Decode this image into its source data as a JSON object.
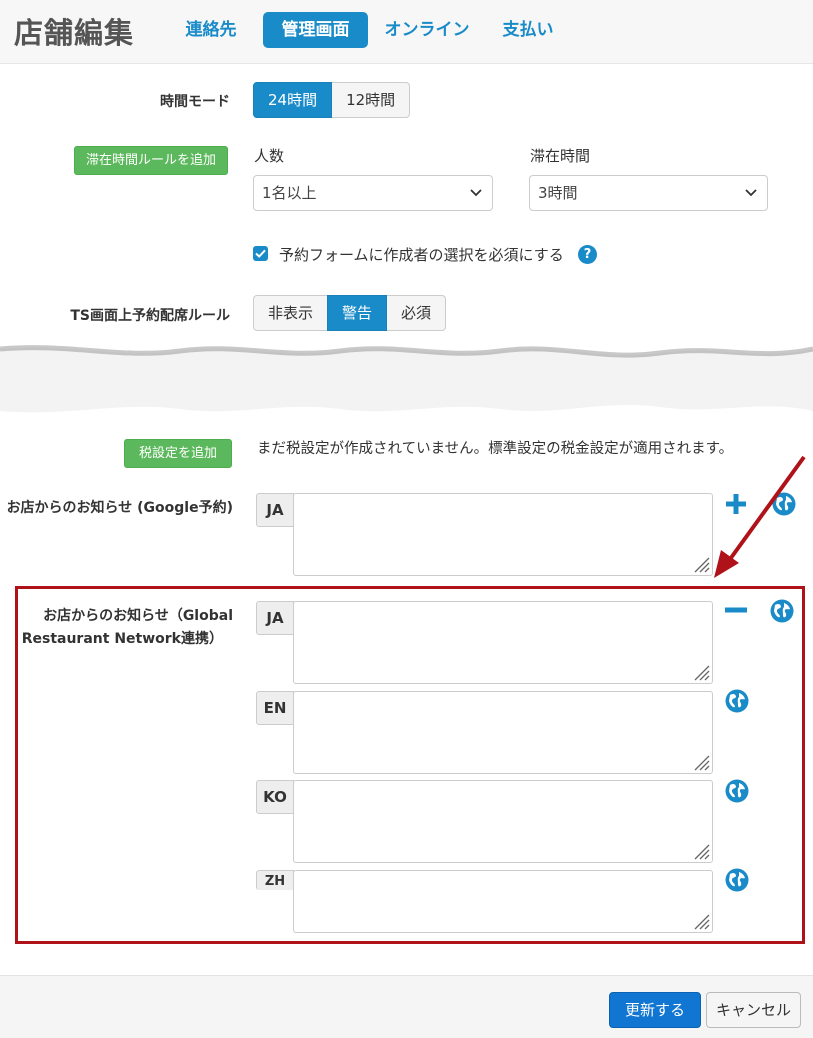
{
  "header": {
    "title": "店舗編集",
    "tabs": [
      {
        "label": "連絡先",
        "active": false
      },
      {
        "label": "管理画面",
        "active": true
      },
      {
        "label": "オンライン",
        "active": false
      },
      {
        "label": "支払い",
        "active": false
      }
    ]
  },
  "time_mode": {
    "label": "時間モード",
    "options": [
      "24時間",
      "12時間"
    ],
    "selected": "24時間"
  },
  "stay_rule": {
    "add_button": "滞在時間ルールを追加",
    "people_label": "人数",
    "people_value": "1名以上",
    "duration_label": "滞在時間",
    "duration_value": "3時間"
  },
  "creator_required": {
    "label": "予約フォームに作成者の選択を必須にする",
    "checked": true
  },
  "ts_rule": {
    "label": "TS画面上予約配席ルール",
    "options": [
      "非表示",
      "警告",
      "必須"
    ],
    "selected": "警告"
  },
  "tax": {
    "add_button": "税設定を追加",
    "message": "まだ税設定が作成されていません。標準設定の税金設定が適用されます。"
  },
  "google_notice": {
    "label": "お店からのお知らせ (Google予約)",
    "lang": "JA",
    "value": ""
  },
  "grn_notice": {
    "label_line1": "お店からのお知らせ（Global",
    "label_line2": "Restaurant Network連携）",
    "langs": [
      {
        "code": "JA",
        "value": ""
      },
      {
        "code": "EN",
        "value": ""
      },
      {
        "code": "KO",
        "value": ""
      },
      {
        "code": "ZH",
        "value": ""
      }
    ]
  },
  "footer": {
    "update_button": "更新する",
    "cancel_button": "キャンセル"
  },
  "colors": {
    "accent": "#1a8bc9",
    "primary": "#1076d1",
    "success": "#5cb85c",
    "annotation": "#b0121a"
  },
  "icons": {
    "help": "question-circle-icon",
    "plus": "plus-icon",
    "minus": "minus-icon",
    "globe": "globe-icon"
  }
}
